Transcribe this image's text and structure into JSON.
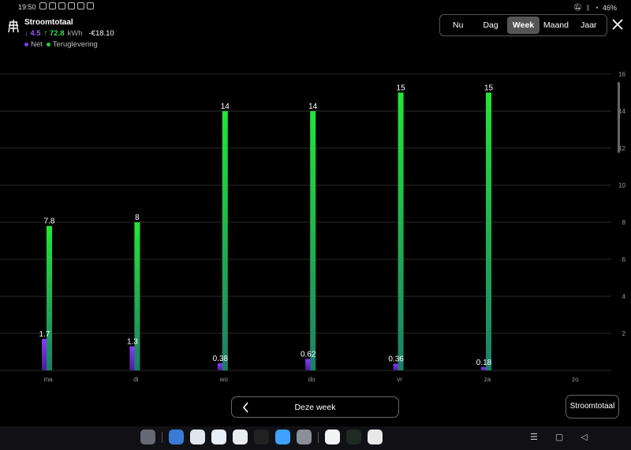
{
  "status_bar": {
    "time": "19:50",
    "battery": "46%"
  },
  "header": {
    "title": "Stroomtotaal",
    "net_value": "↓ 4.5",
    "feed_value": "↑ 72.8",
    "unit": "kWh",
    "cost": "-€18.10",
    "legend": [
      {
        "label": "Net",
        "color": "#7b3fe4"
      },
      {
        "label": "Teruglevering",
        "color": "#2ecc40"
      }
    ]
  },
  "tabs": [
    {
      "label": "Nu",
      "active": false
    },
    {
      "label": "Dag",
      "active": false
    },
    {
      "label": "Week",
      "active": true
    },
    {
      "label": "Maand",
      "active": false
    },
    {
      "label": "Jaar",
      "active": false
    }
  ],
  "chart_data": {
    "type": "bar",
    "categories": [
      "ma",
      "di",
      "wo",
      "do",
      "vr",
      "za",
      "zo"
    ],
    "series": [
      {
        "name": "Net",
        "values": [
          1.7,
          1.3,
          0.38,
          0.62,
          0.36,
          0.18,
          null
        ],
        "labels": [
          "1.7",
          "1.3",
          "0.38",
          "0.62",
          "0.36",
          "0.18",
          ""
        ],
        "color": "#7b3fe4"
      },
      {
        "name": "Teruglevering",
        "values": [
          7.8,
          8,
          14,
          14,
          15,
          15,
          null
        ],
        "labels": [
          "7.8",
          "8",
          "14",
          "14",
          "15",
          "15",
          ""
        ],
        "color": "#2ecc40"
      }
    ],
    "y_ticks": [
      "0",
      "2",
      "4",
      "6",
      "8",
      "10",
      "12",
      "14",
      "16"
    ],
    "ylim": [
      0,
      16
    ],
    "grid": true
  },
  "footer": {
    "week_label": "Deze week",
    "total_button": "Stroomtotaal"
  },
  "dock": {
    "apps": [
      {
        "name": "apps-grid-icon",
        "color": "#666a75"
      },
      {
        "name": "files-icon",
        "color": "#3a7bd5"
      },
      {
        "name": "phone-icon",
        "color": "#dfe6ef"
      },
      {
        "name": "messages-icon",
        "color": "#e8eef8"
      },
      {
        "name": "chrome-icon",
        "color": "#e9ecef"
      },
      {
        "name": "camera-icon",
        "color": "#222"
      },
      {
        "name": "gallery-icon",
        "color": "#3fa0ff"
      },
      {
        "name": "settings-icon",
        "color": "#8a8f99"
      },
      {
        "name": "google-icon",
        "color": "#f1f3f4"
      },
      {
        "name": "energy-app-icon",
        "color": "#1e2a22"
      },
      {
        "name": "youtube-icon",
        "color": "#e8e8e8"
      }
    ]
  }
}
